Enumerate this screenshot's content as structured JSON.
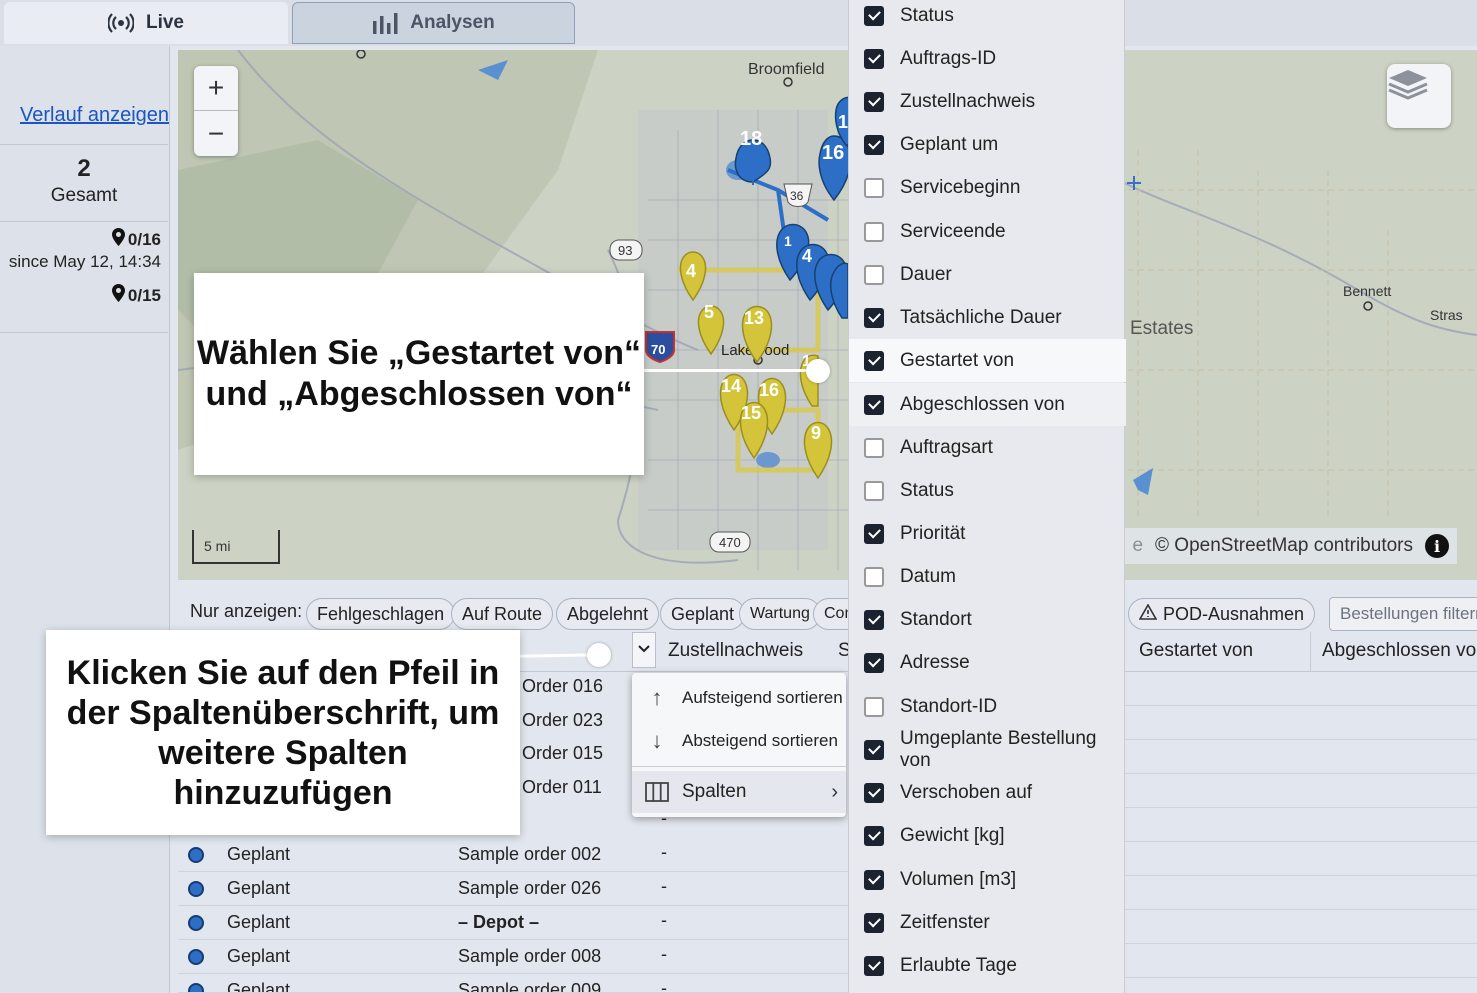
{
  "tabs": [
    {
      "label": "Live",
      "icon": "broadcast-icon"
    },
    {
      "label": "Analysen",
      "icon": "bar-chart-icon"
    }
  ],
  "sidebar": {
    "history_link": "Verlauf anzeigen",
    "total_count": "2",
    "total_label": "Gesamt",
    "stat1": "0/16",
    "since": "since May 12, 14:34",
    "stat2": "0/15"
  },
  "map": {
    "zoom_in": "+",
    "zoom_out": "−",
    "scale_label": "5 mi",
    "attribution_prefix": "e",
    "attribution": "© OpenStreetMap contributors",
    "labels": {
      "broomfield": "Broomfield",
      "lakewood": "Lakewood",
      "bennett": "Bennett",
      "estates": "Estates",
      "stras": "Stras"
    },
    "road_shields": [
      "93",
      "70",
      "470",
      "36"
    ],
    "blue_markers": [
      "18",
      "16",
      "1",
      "1",
      "4"
    ],
    "yellow_markers": [
      "4",
      "5",
      "13",
      "14",
      "16",
      "15",
      "9",
      "1"
    ]
  },
  "filters": {
    "label": "Nur anzeigen:",
    "chips": [
      "Fehlgeschlagen",
      "Auf Route",
      "Abgelehnt",
      "Geplant",
      "Wartung",
      "Com"
    ],
    "pod_chip": "POD-Ausnahmen",
    "search_placeholder": "Bestellungen filtern..."
  },
  "table": {
    "headers": {
      "proof": "Zustellnachweis",
      "s": "S",
      "started_by": "Gestartet von",
      "finished_by": "Abgeschlossen von"
    },
    "partial_orders": [
      "Order 016",
      "Order 023",
      "Order 015",
      "Order 011"
    ],
    "rows": [
      {
        "status": "Geplant",
        "order": "Sample order 002",
        "proof": "-"
      },
      {
        "status": "Geplant",
        "order": "Sample order 026",
        "proof": "-"
      },
      {
        "status": "Geplant",
        "order": "– Depot –",
        "proof": "-"
      },
      {
        "status": "Geplant",
        "order": "Sample order 008",
        "proof": "-"
      },
      {
        "status": "Geplant",
        "order": "Sample order 009",
        "proof": "-"
      }
    ],
    "extra_dash": "-"
  },
  "column_menu": {
    "sort_asc": "Aufsteigend sortieren",
    "sort_desc": "Absteigend sortieren",
    "columns": "Spalten"
  },
  "columns_panel": [
    {
      "label": "Status",
      "checked": true
    },
    {
      "label": "Auftrags-ID",
      "checked": true
    },
    {
      "label": "Zustellnachweis",
      "checked": true
    },
    {
      "label": "Geplant um",
      "checked": true
    },
    {
      "label": "Servicebeginn",
      "checked": false
    },
    {
      "label": "Serviceende",
      "checked": false
    },
    {
      "label": "Dauer",
      "checked": false
    },
    {
      "label": "Tatsächliche Dauer",
      "checked": true
    },
    {
      "label": "Gestartet von",
      "checked": true
    },
    {
      "label": "Abgeschlossen von",
      "checked": true
    },
    {
      "label": "Auftragsart",
      "checked": false
    },
    {
      "label": "Status",
      "checked": false
    },
    {
      "label": "Priorität",
      "checked": true
    },
    {
      "label": "Datum",
      "checked": false
    },
    {
      "label": "Standort",
      "checked": true
    },
    {
      "label": "Adresse",
      "checked": true
    },
    {
      "label": "Standort-ID",
      "checked": false
    },
    {
      "label": "Umgeplante Bestellung von",
      "checked": true
    },
    {
      "label": "Verschoben auf",
      "checked": true
    },
    {
      "label": "Gewicht [kg]",
      "checked": true
    },
    {
      "label": "Volumen [m3]",
      "checked": true
    },
    {
      "label": "Zeitfenster",
      "checked": true
    },
    {
      "label": "Erlaubte Tage",
      "checked": true
    }
  ],
  "callouts": {
    "select": "Wählen Sie „Gestartet von“ und „Abgeschlossen von“",
    "click_arrow": "Klicken Sie auf den Pfeil in der Spaltenüberschrift, um weitere Spalten hinzuzufügen"
  },
  "colors": {
    "accent_blue": "#2d6fc6",
    "marker_yellow": "#d4c43a",
    "link": "#1a55c2"
  }
}
